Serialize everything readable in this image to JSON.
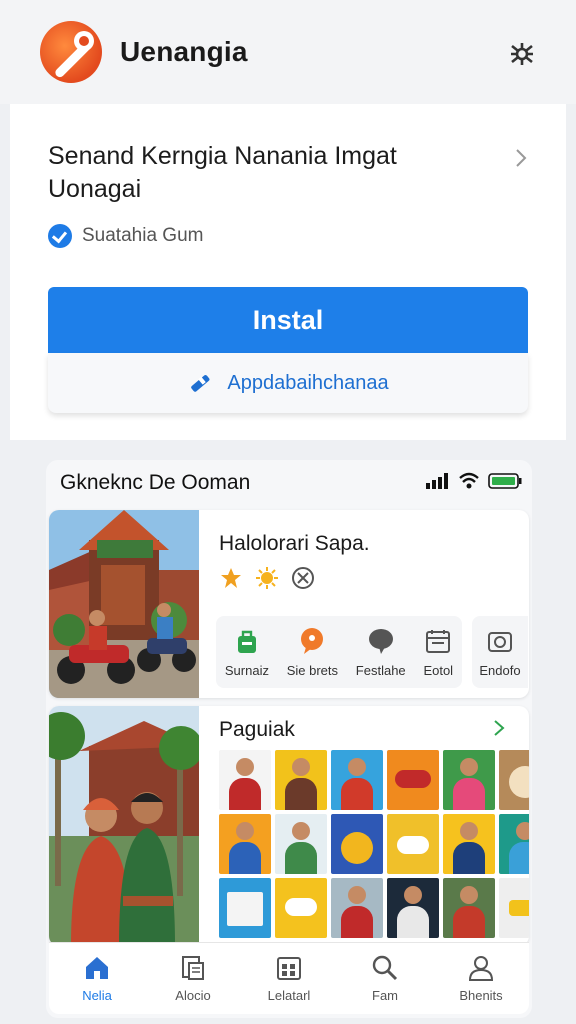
{
  "header": {
    "app_name": "Uenangia",
    "settings_icon": "gear-icon"
  },
  "install_card": {
    "title": "Senand Kerngia Nanania Imgat Uonagai",
    "verified_text": "Suatahia Gum",
    "install_label": "Instal",
    "secondary_label": "Appdabaihchanaa"
  },
  "phone": {
    "status_title": "Gkneknc De Ooman",
    "feature": {
      "title": "Halolorari Sapa.",
      "quick_actions": [
        {
          "label": "Surnaiz",
          "icon": "bag-icon",
          "color": "#2ea44f"
        },
        {
          "label": "Sie brets",
          "icon": "speech-bubble-icon",
          "color": "#f07a2a"
        },
        {
          "label": "Festlahe",
          "icon": "chat-icon",
          "color": "#555555"
        },
        {
          "label": "Eotol",
          "icon": "calendar-icon",
          "color": "#555555"
        }
      ],
      "extra_action": {
        "label": "Endofo",
        "icon": "camera-icon"
      }
    },
    "gallery": {
      "title": "Paguiak"
    },
    "nav": [
      {
        "label": "Nelia",
        "icon": "home-icon",
        "active": true
      },
      {
        "label": "Alocio",
        "icon": "document-icon",
        "active": false
      },
      {
        "label": "Lelatarl",
        "icon": "calendar-grid-icon",
        "active": false
      },
      {
        "label": "Fam",
        "icon": "search-icon",
        "active": false
      },
      {
        "label": "Bhenits",
        "icon": "person-icon",
        "active": false
      }
    ]
  },
  "colors": {
    "accent": "#1e7fe9",
    "brand": "#e34a1e"
  }
}
